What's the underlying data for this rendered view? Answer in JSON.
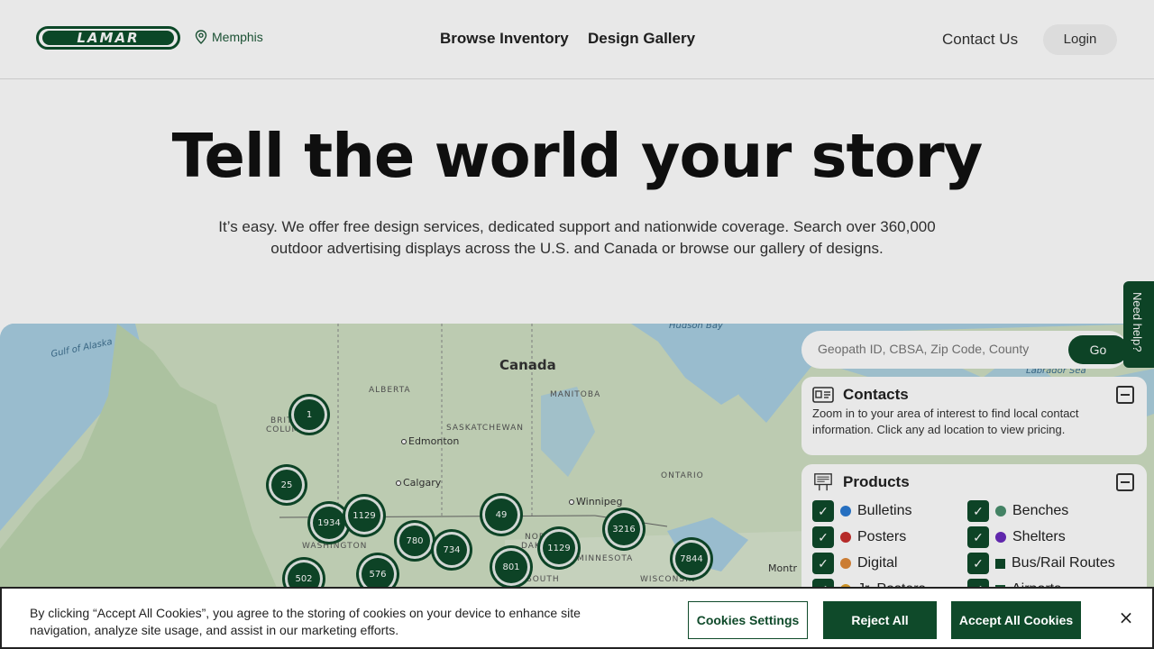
{
  "header": {
    "location": "Memphis",
    "nav_browse": "Browse Inventory",
    "nav_design": "Design Gallery",
    "contact": "Contact Us",
    "login": "Login",
    "brand_color": "#0f4a2a"
  },
  "hero": {
    "title": "Tell the world your story",
    "subtitle": "It’s easy. We offer free design services, dedicated support and nationwide coverage. Search over 360,000 outdoor advertising displays across the U.S. and Canada or browse our gallery of designs."
  },
  "map": {
    "labels": {
      "canada": "Canada",
      "alberta": "ALBERTA",
      "manitoba": "MANITOBA",
      "saskatchewan": "SASKATCHEWAN",
      "british_columbia_1": "BRITISH",
      "british_columbia_2": "COLUMBIA",
      "ontario": "ONTARIO",
      "washington": "WASHINGTON",
      "minnesota": "MINNESOTA",
      "north_dakota_1": "NORTH",
      "north_dakota_2": "DAKOTA",
      "south_dakota": "SOUTH",
      "wisconsin": "WISCONSIN",
      "edmonton": "Edmonton",
      "calgary": "Calgary",
      "winnipeg": "Winnipeg",
      "montreal": "Montr",
      "gulf_of_alaska": "Gulf of Alaska",
      "hudson_bay": "Hudson Bay",
      "labrador_sea": "Labrador Sea"
    },
    "clusters": [
      "1",
      "25",
      "1934",
      "1129",
      "780",
      "734",
      "49",
      "1129",
      "801",
      "3216",
      "7844",
      "502",
      "576"
    ]
  },
  "search": {
    "placeholder": "Geopath ID, CBSA, Zip Code, County",
    "go_label": "Go"
  },
  "contacts": {
    "title": "Contacts",
    "text": "Zoom in to your area of interest to find local contact information. Click any ad location to view pricing."
  },
  "products": {
    "title": "Products",
    "items": [
      {
        "label": "Bulletins",
        "color": "#2a7bd4"
      },
      {
        "label": "Benches",
        "color": "#4a8f6e"
      },
      {
        "label": "Posters",
        "color": "#c8302e"
      },
      {
        "label": "Shelters",
        "color": "#6a2bbd"
      },
      {
        "label": "Digital",
        "color": "#e08a3a"
      },
      {
        "label": "Bus/Rail Routes",
        "color": "#0f4a2a"
      },
      {
        "label": "Jr. Posters",
        "color": "#e0a02a"
      },
      {
        "label": "Airports",
        "color": "#1a5a36"
      }
    ]
  },
  "help": {
    "label": "Need help?"
  },
  "cookie": {
    "text": "By clicking “Accept All Cookies”, you agree to the storing of cookies on your device to enhance site navigation, analyze site usage, and assist in our marketing efforts.",
    "settings": "Cookies Settings",
    "reject": "Reject All",
    "accept": "Accept All Cookies",
    "close": "×"
  }
}
